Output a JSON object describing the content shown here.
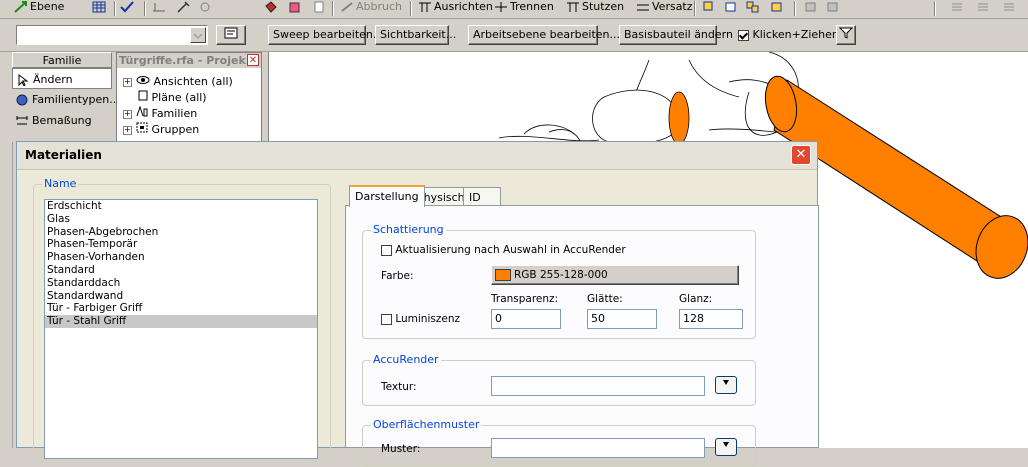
{
  "toolbar1": {
    "ebene_label": "Ebene",
    "abbruch_label": "Abbruch",
    "ausrichten_label": "Ausrichten",
    "trennen_label": "Trennen",
    "stutzen_label": "Stutzen",
    "versatz_label": "Versatz"
  },
  "toolbar2": {
    "combo_value": "",
    "sweep_label": "Sweep bearbeiten...",
    "sicht_label": "Sichtbarkeit...",
    "arbeitsebene_label": "Arbeitsebene bearbeiten...",
    "basisbauteil_label": "Basisbauteil ändern",
    "klicken_label": "Klicken+Ziehen",
    "klicken_checked": true
  },
  "family_panel": {
    "header": "Familie",
    "items": [
      {
        "label": "Ändern",
        "icon": "arrow-cursor-icon"
      },
      {
        "label": "Familientypen...",
        "icon": "family-types-icon"
      },
      {
        "label": "Bemaßung",
        "icon": "dimension-icon"
      }
    ]
  },
  "project_panel": {
    "title": "Türgriffe.rfa - Projek...",
    "tree": [
      {
        "label": "Ansichten (all)",
        "expander": true,
        "icon": "eye-icon"
      },
      {
        "label": "Pläne (all)",
        "expander": false,
        "icon": "sheet-icon"
      },
      {
        "label": "Familien",
        "expander": true,
        "icon": "families-icon"
      },
      {
        "label": "Gruppen",
        "expander": true,
        "icon": "groups-icon"
      }
    ]
  },
  "dialog": {
    "title": "Materialien",
    "name_group_label": "Name",
    "materials": [
      "Erdschicht",
      "Glas",
      "Phasen-Abgebrochen",
      "Phasen-Temporär",
      "Phasen-Vorhanden",
      "Standard",
      "Standarddach",
      "Standardwand",
      "Tür - Farbiger Griff",
      "Tür - Stahl Griff"
    ],
    "selected_index": 9,
    "tabs": [
      "Darstellung",
      "Physisch",
      "ID"
    ],
    "active_tab": 0,
    "schattierung": {
      "label": "Schattierung",
      "accu_update_label": "Aktualisierung nach Auswahl in AccuRender",
      "accu_update_checked": false,
      "farbe_label": "Farbe:",
      "farbe_value": "RGB 255-128-000",
      "farbe_hex": "#ff8000",
      "transparenz_label": "Transparenz:",
      "glaette_label": "Glätte:",
      "glanz_label": "Glanz:",
      "lumineszenz_label": "Luminiszenz",
      "lumineszenz_checked": false,
      "transparenz_value": "0",
      "glaette_value": "50",
      "glanz_value": "128"
    },
    "accurender": {
      "label": "AccuRender",
      "textur_label": "Textur:",
      "textur_value": ""
    },
    "oberflaeche": {
      "label": "Oberflächenmuster",
      "muster_label": "Muster:",
      "muster_value": ""
    }
  },
  "colors": {
    "handle_orange": "#ff8000",
    "dialog_bg": "#ece9d8",
    "group_label": "#0046d5",
    "close_button": "#e04830"
  }
}
